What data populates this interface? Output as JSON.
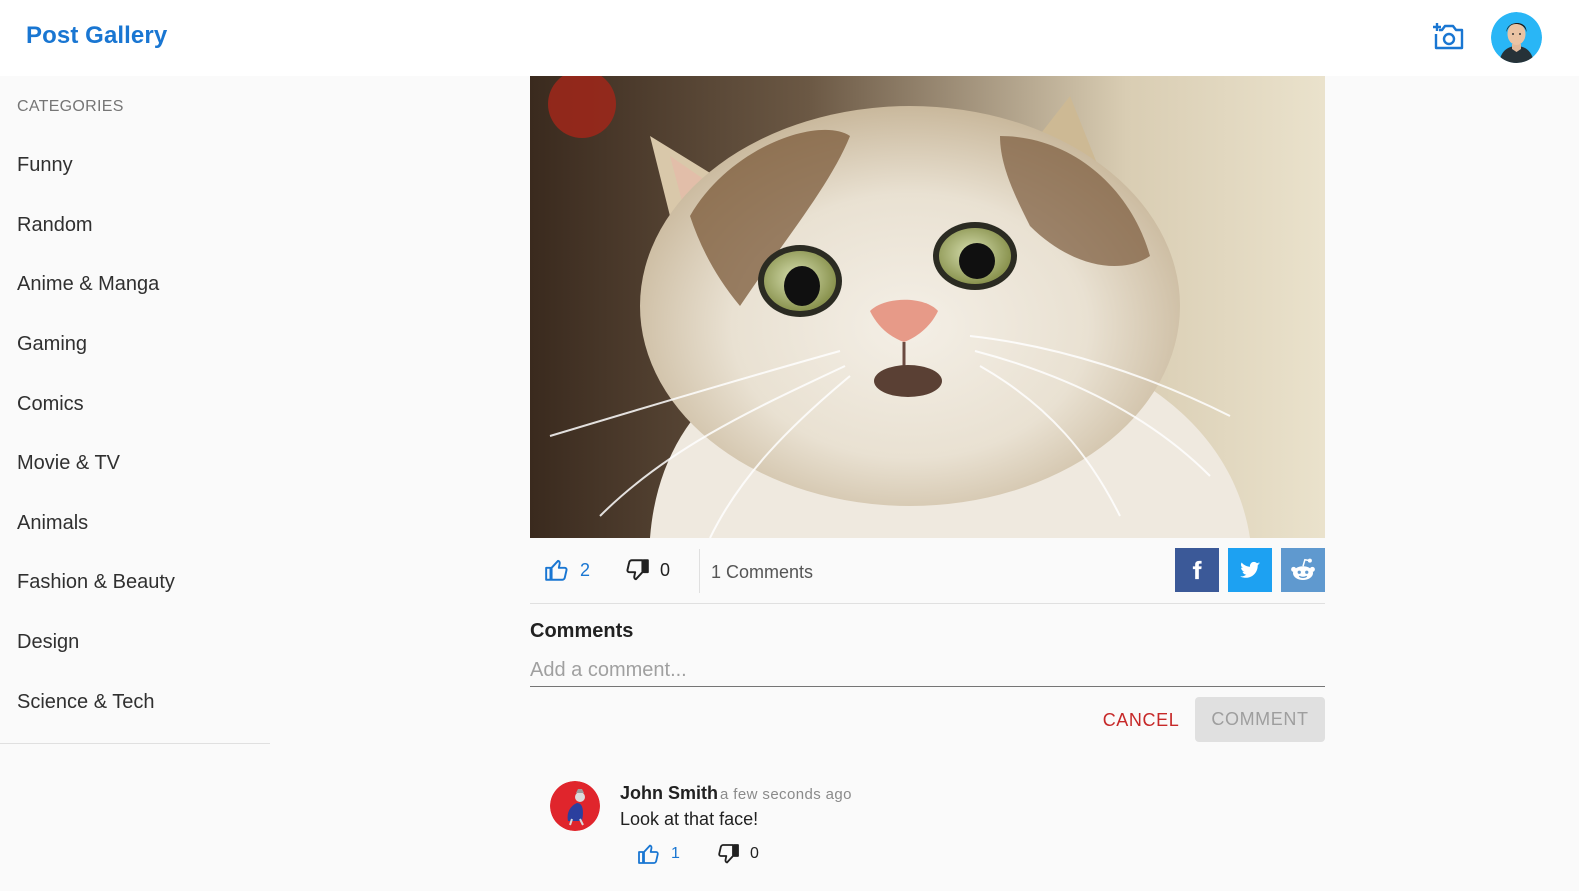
{
  "header": {
    "brand": "Post Gallery",
    "add_photo_icon": "add-a-photo-icon",
    "avatar_icon": "user-avatar"
  },
  "sidebar": {
    "title": "CATEGORIES",
    "items": [
      {
        "label": "Funny"
      },
      {
        "label": "Random"
      },
      {
        "label": "Anime & Manga"
      },
      {
        "label": "Gaming"
      },
      {
        "label": "Comics"
      },
      {
        "label": "Movie & TV"
      },
      {
        "label": "Animals"
      },
      {
        "label": "Fashion & Beauty"
      },
      {
        "label": "Design"
      },
      {
        "label": "Science & Tech"
      }
    ]
  },
  "post": {
    "image_desc_icon": "surprised-cat-photo",
    "upvotes": "2",
    "downvotes": "0",
    "comments_count": "1 Comments",
    "share": {
      "facebook_icon": "facebook-icon",
      "twitter_icon": "twitter-icon",
      "reddit_icon": "reddit-icon"
    }
  },
  "comments": {
    "heading": "Comments",
    "placeholder": "Add a comment...",
    "cancel_label": "CANCEL",
    "submit_label": "COMMENT",
    "items": [
      {
        "author": "John Smith",
        "time": "a few seconds ago",
        "text": "Look at that face!",
        "upvotes": "1",
        "downvotes": "0"
      }
    ]
  },
  "colors": {
    "primary": "#1976d2",
    "cancel": "#c62828",
    "facebook": "#3b5998",
    "twitter": "#1da1f2",
    "reddit": "#5f99cf",
    "background": "#fafafa"
  }
}
